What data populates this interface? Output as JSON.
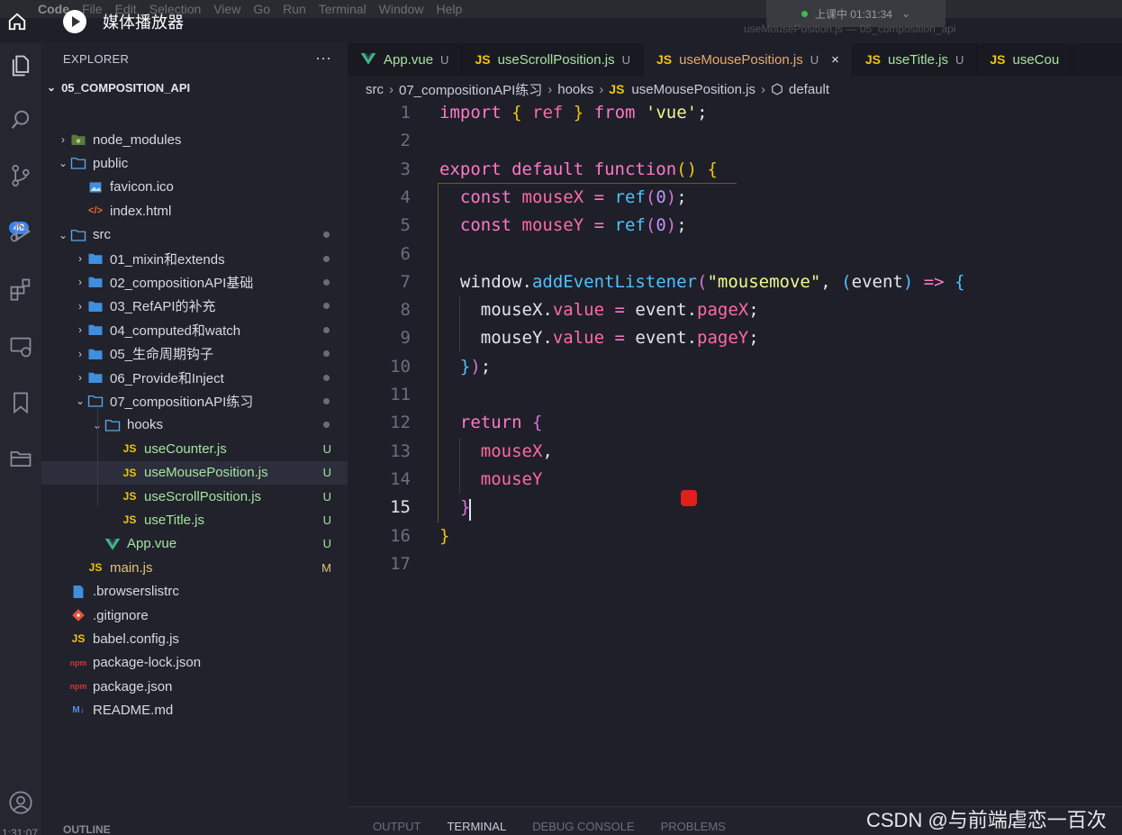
{
  "menubar": {
    "app": "Code",
    "items": [
      "File",
      "Edit",
      "Selection",
      "View",
      "Go",
      "Run",
      "Terminal",
      "Window",
      "Help"
    ]
  },
  "recording": {
    "label": "上课中 01:31:34",
    "chevron": "⌄"
  },
  "window_title": "useMousePosition.js — 05_composition_api",
  "player": {
    "title": "媒体播放器"
  },
  "activity": {
    "badge": "40",
    "timecode": "1:31:07"
  },
  "explorer": {
    "header": "EXPLORER",
    "more": "···",
    "project": "05_COMPOSITION_API",
    "outline": "OUTLINE",
    "rows": [
      {
        "label": "node_modules",
        "chev": "›",
        "icon": "node",
        "depth": 1,
        "status": ""
      },
      {
        "label": "public",
        "chev": "⌄",
        "icon": "folder",
        "depth": 1,
        "status": ""
      },
      {
        "label": "favicon.ico",
        "chev": "",
        "icon": "image",
        "depth": 2,
        "status": ""
      },
      {
        "label": "index.html",
        "chev": "",
        "icon": "html",
        "depth": 2,
        "status": ""
      },
      {
        "label": "src",
        "chev": "⌄",
        "icon": "folder",
        "depth": 1,
        "status": "dot"
      },
      {
        "label": "01_mixin和extends",
        "chev": "›",
        "icon": "folder-blue",
        "depth": 2,
        "status": "dot"
      },
      {
        "label": "02_compositionAPI基础",
        "chev": "›",
        "icon": "folder-blue",
        "depth": 2,
        "status": "dot"
      },
      {
        "label": "03_RefAPI的补充",
        "chev": "›",
        "icon": "folder-blue",
        "depth": 2,
        "status": "dot"
      },
      {
        "label": "04_computed和watch",
        "chev": "›",
        "icon": "folder-blue",
        "depth": 2,
        "status": "dot"
      },
      {
        "label": "05_生命周期钩子",
        "chev": "›",
        "icon": "folder-blue",
        "depth": 2,
        "status": "dot"
      },
      {
        "label": "06_Provide和Inject",
        "chev": "›",
        "icon": "folder-blue",
        "depth": 2,
        "status": "dot"
      },
      {
        "label": "07_compositionAPI练习",
        "chev": "⌄",
        "icon": "folder",
        "depth": 2,
        "status": "dot"
      },
      {
        "label": "hooks",
        "chev": "⌄",
        "icon": "folder",
        "depth": 3,
        "status": "dot"
      },
      {
        "label": "useCounter.js",
        "chev": "",
        "icon": "js",
        "depth": 4,
        "status": "U"
      },
      {
        "label": "useMousePosition.js",
        "chev": "",
        "icon": "js",
        "depth": 4,
        "status": "U",
        "selected": true
      },
      {
        "label": "useScrollPosition.js",
        "chev": "",
        "icon": "js",
        "depth": 4,
        "status": "U"
      },
      {
        "label": "useTitle.js",
        "chev": "",
        "icon": "js",
        "depth": 4,
        "status": "U"
      },
      {
        "label": "App.vue",
        "chev": "",
        "icon": "vue",
        "depth": 3,
        "status": "U"
      },
      {
        "label": "main.js",
        "chev": "",
        "icon": "js",
        "depth": 2,
        "status": "M"
      },
      {
        "label": ".browserslistrc",
        "chev": "",
        "icon": "file-blue",
        "depth": 1,
        "status": ""
      },
      {
        "label": ".gitignore",
        "chev": "",
        "icon": "git",
        "depth": 1,
        "status": ""
      },
      {
        "label": "babel.config.js",
        "chev": "",
        "icon": "js",
        "depth": 1,
        "status": ""
      },
      {
        "label": "package-lock.json",
        "chev": "",
        "icon": "npm",
        "depth": 1,
        "status": ""
      },
      {
        "label": "package.json",
        "chev": "",
        "icon": "npm",
        "depth": 1,
        "status": ""
      },
      {
        "label": "README.md",
        "chev": "",
        "icon": "md",
        "depth": 1,
        "status": ""
      }
    ]
  },
  "icon_text": {
    "js": "JS",
    "npm": "npm",
    "md": "M↓",
    "html": "</>"
  },
  "tabs": [
    {
      "label": "App.vue",
      "icon": "vue",
      "status": "U"
    },
    {
      "label": "useScrollPosition.js",
      "icon": "js",
      "status": "U"
    },
    {
      "label": "useMousePosition.js",
      "icon": "js",
      "status": "U",
      "active": true,
      "close": "×"
    },
    {
      "label": "useTitle.js",
      "icon": "js",
      "status": "U"
    },
    {
      "label": "useCou",
      "icon": "js",
      "status": ""
    }
  ],
  "breadcrumb": {
    "parts": [
      "src",
      "07_compositionAPI练习",
      "hooks"
    ],
    "file": "useMousePosition.js",
    "symbol": "default",
    "sep": "›"
  },
  "editor": {
    "current_line": 15,
    "lines": [
      [
        [
          "k",
          "import"
        ],
        [
          "t",
          " "
        ],
        [
          "b1",
          "{"
        ],
        [
          "t",
          " "
        ],
        [
          "id",
          "ref"
        ],
        [
          "t",
          " "
        ],
        [
          "b1",
          "}"
        ],
        [
          "t",
          " "
        ],
        [
          "k",
          "from"
        ],
        [
          "t",
          " "
        ],
        [
          "s",
          "'vue'"
        ],
        [
          "t",
          ";"
        ]
      ],
      [],
      [
        [
          "k",
          "export"
        ],
        [
          "t",
          " "
        ],
        [
          "k",
          "default"
        ],
        [
          "t",
          " "
        ],
        [
          "k",
          "function"
        ],
        [
          "b1",
          "()"
        ],
        [
          "t",
          " "
        ],
        [
          "b1",
          "{"
        ]
      ],
      [
        [
          "t",
          "  "
        ],
        [
          "k",
          "const"
        ],
        [
          "t",
          " "
        ],
        [
          "id",
          "mouseX"
        ],
        [
          "t",
          " "
        ],
        [
          "k",
          "="
        ],
        [
          "t",
          " "
        ],
        [
          "b3",
          "ref"
        ],
        [
          "b2",
          "("
        ],
        [
          "n",
          "0"
        ],
        [
          "b2",
          ")"
        ],
        [
          "t",
          ";"
        ]
      ],
      [
        [
          "t",
          "  "
        ],
        [
          "k",
          "const"
        ],
        [
          "t",
          " "
        ],
        [
          "id",
          "mouseY"
        ],
        [
          "t",
          " "
        ],
        [
          "k",
          "="
        ],
        [
          "t",
          " "
        ],
        [
          "b3",
          "ref"
        ],
        [
          "b2",
          "("
        ],
        [
          "n",
          "0"
        ],
        [
          "b2",
          ")"
        ],
        [
          "t",
          ";"
        ]
      ],
      [],
      [
        [
          "t",
          "  window."
        ],
        [
          "b3",
          "addEventListener"
        ],
        [
          "b2",
          "("
        ],
        [
          "s",
          "\"mousemove\""
        ],
        [
          "t",
          ", "
        ],
        [
          "b3",
          "("
        ],
        [
          "t",
          "event"
        ],
        [
          "b3",
          ")"
        ],
        [
          "t",
          " "
        ],
        [
          "k",
          "=>"
        ],
        [
          "t",
          " "
        ],
        [
          "b3",
          "{"
        ]
      ],
      [
        [
          "t",
          "    mouseX."
        ],
        [
          "id",
          "value"
        ],
        [
          "t",
          " "
        ],
        [
          "k",
          "="
        ],
        [
          "t",
          " event."
        ],
        [
          "id",
          "pageX"
        ],
        [
          "t",
          ";"
        ]
      ],
      [
        [
          "t",
          "    mouseY."
        ],
        [
          "id",
          "value"
        ],
        [
          "t",
          " "
        ],
        [
          "k",
          "="
        ],
        [
          "t",
          " event."
        ],
        [
          "id",
          "pageY"
        ],
        [
          "t",
          ";"
        ]
      ],
      [
        [
          "t",
          "  "
        ],
        [
          "b3",
          "}"
        ],
        [
          "b2",
          ")"
        ],
        [
          "t",
          ";"
        ]
      ],
      [],
      [
        [
          "t",
          "  "
        ],
        [
          "k",
          "return"
        ],
        [
          "t",
          " "
        ],
        [
          "b2",
          "{"
        ]
      ],
      [
        [
          "t",
          "    "
        ],
        [
          "id",
          "mouseX"
        ],
        [
          "t",
          ","
        ]
      ],
      [
        [
          "t",
          "    "
        ],
        [
          "id",
          "mouseY"
        ]
      ],
      [
        [
          "t",
          "  "
        ],
        [
          "b2",
          "}"
        ]
      ],
      [
        [
          "b1",
          "}"
        ]
      ],
      []
    ]
  },
  "panel": {
    "tabs": [
      "OUTPUT",
      "TERMINAL",
      "DEBUG CONSOLE",
      "PROBLEMS"
    ],
    "active": "TERMINAL"
  },
  "watermark": "CSDN @与前端虐恋一百次",
  "colors": {
    "accent": "#e9a96b",
    "badge": "#3b82f6",
    "record_dot": "#e0201b"
  }
}
